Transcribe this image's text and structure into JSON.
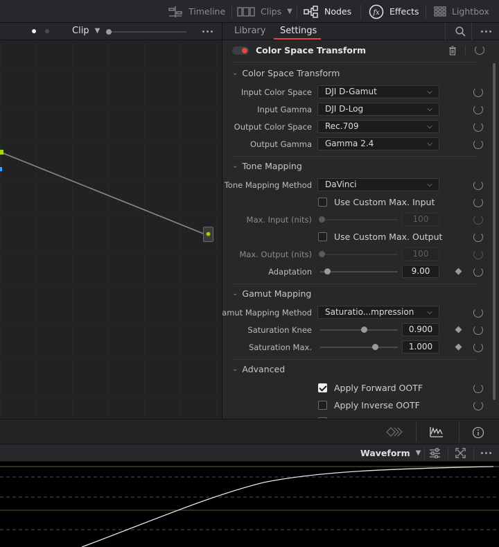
{
  "topbar": {
    "timeline": "Timeline",
    "clips": "Clips",
    "nodes": "Nodes",
    "effects": "Effects",
    "lightbox": "Lightbox"
  },
  "nodebar": {
    "mode": "Clip"
  },
  "inspector": {
    "tabs": [
      "Library",
      "Settings"
    ],
    "effect_title": "Color Space Transform",
    "sections": {
      "cst": {
        "title": "Color Space Transform",
        "input_color_space": {
          "label": "Input Color Space",
          "value": "DJI D-Gamut"
        },
        "input_gamma": {
          "label": "Input Gamma",
          "value": "DJI D-Log"
        },
        "output_color_space": {
          "label": "Output Color Space",
          "value": "Rec.709"
        },
        "output_gamma": {
          "label": "Output Gamma",
          "value": "Gamma 2.4"
        }
      },
      "tone": {
        "title": "Tone Mapping",
        "method": {
          "label": "Tone Mapping Method",
          "value": "DaVinci"
        },
        "custom_input": {
          "label": "Use Custom Max. Input",
          "checked": false
        },
        "max_input": {
          "label": "Max. Input (nits)",
          "value": "100"
        },
        "custom_output": {
          "label": "Use Custom Max. Output",
          "checked": false
        },
        "max_output": {
          "label": "Max. Output (nits)",
          "value": "100"
        },
        "adaptation": {
          "label": "Adaptation",
          "value": "9.00"
        }
      },
      "gamut": {
        "title": "Gamut Mapping",
        "method": {
          "label": "Gamut Mapping Method",
          "value": "Saturatio...mpression"
        },
        "sat_knee": {
          "label": "Saturation Knee",
          "value": "0.900"
        },
        "sat_max": {
          "label": "Saturation Max.",
          "value": "1.000"
        }
      },
      "advanced": {
        "title": "Advanced",
        "forward_ootf": {
          "label": "Apply Forward OOTF",
          "checked": true
        },
        "inverse_ootf": {
          "label": "Apply Inverse OOTF",
          "checked": false
        }
      }
    }
  },
  "scope": {
    "mode": "Waveform"
  },
  "colors": {
    "accent": "#e64545",
    "node_green": "#a6d21a",
    "underline": "#e64545"
  }
}
